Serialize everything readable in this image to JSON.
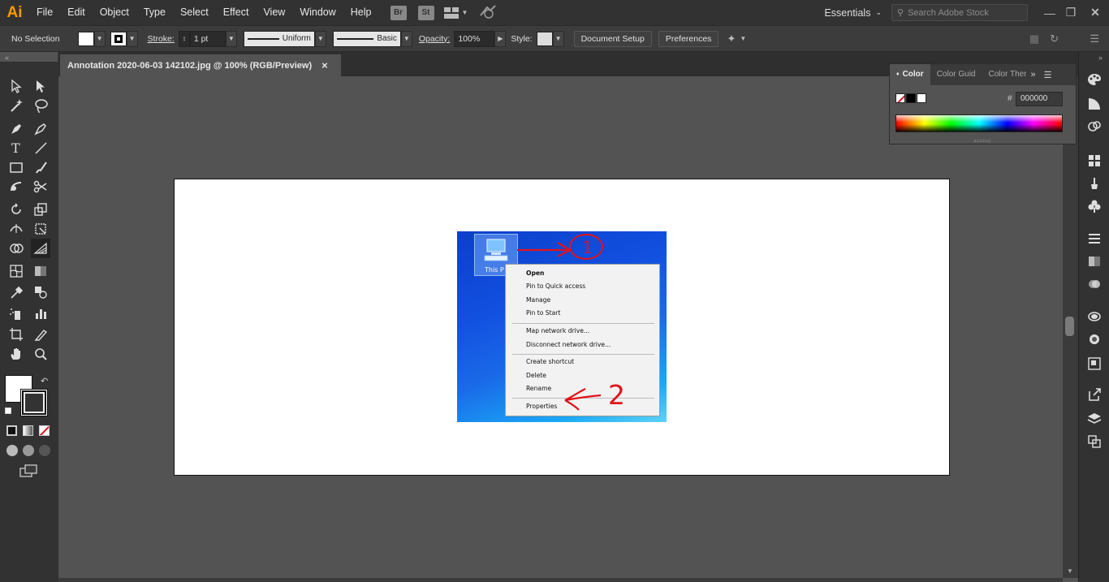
{
  "app": {
    "logo": "Ai"
  },
  "menu": [
    "File",
    "Edit",
    "Object",
    "Type",
    "Select",
    "Effect",
    "View",
    "Window",
    "Help"
  ],
  "bridge_btn": "Br",
  "stock_btn": "St",
  "workspace": "Essentials",
  "search": {
    "placeholder": "Search Adobe Stock"
  },
  "control": {
    "selection": "No Selection",
    "stroke_label": "Stroke:",
    "stroke_weight": "1 pt",
    "profile": "Uniform",
    "brush": "Basic",
    "opacity_label": "Opacity:",
    "opacity": "100%",
    "style_label": "Style:",
    "document_setup": "Document Setup",
    "preferences": "Preferences"
  },
  "document": {
    "tab_title": "Annotation 2020-06-03 142102.jpg @ 100% (RGB/Preview)",
    "close": "×"
  },
  "color_panel": {
    "tabs": [
      "Color",
      "Color Guid",
      "Color Ther"
    ],
    "hex_label": "#",
    "hex_value": "000000"
  },
  "placed_image": {
    "icon_label": "This P",
    "menu_items": [
      "Open",
      "Pin to Quick access",
      "Manage",
      "Pin to Start",
      "Map network drive...",
      "Disconnect network drive...",
      "Create shortcut",
      "Delete",
      "Rename",
      "Properties"
    ],
    "annotation_1": "1",
    "annotation_2": "2"
  },
  "colors": {
    "accent": "#ff9a00",
    "annotation_red": "#e1121b",
    "ui_dark": "#323232",
    "canvas": "#535353"
  }
}
